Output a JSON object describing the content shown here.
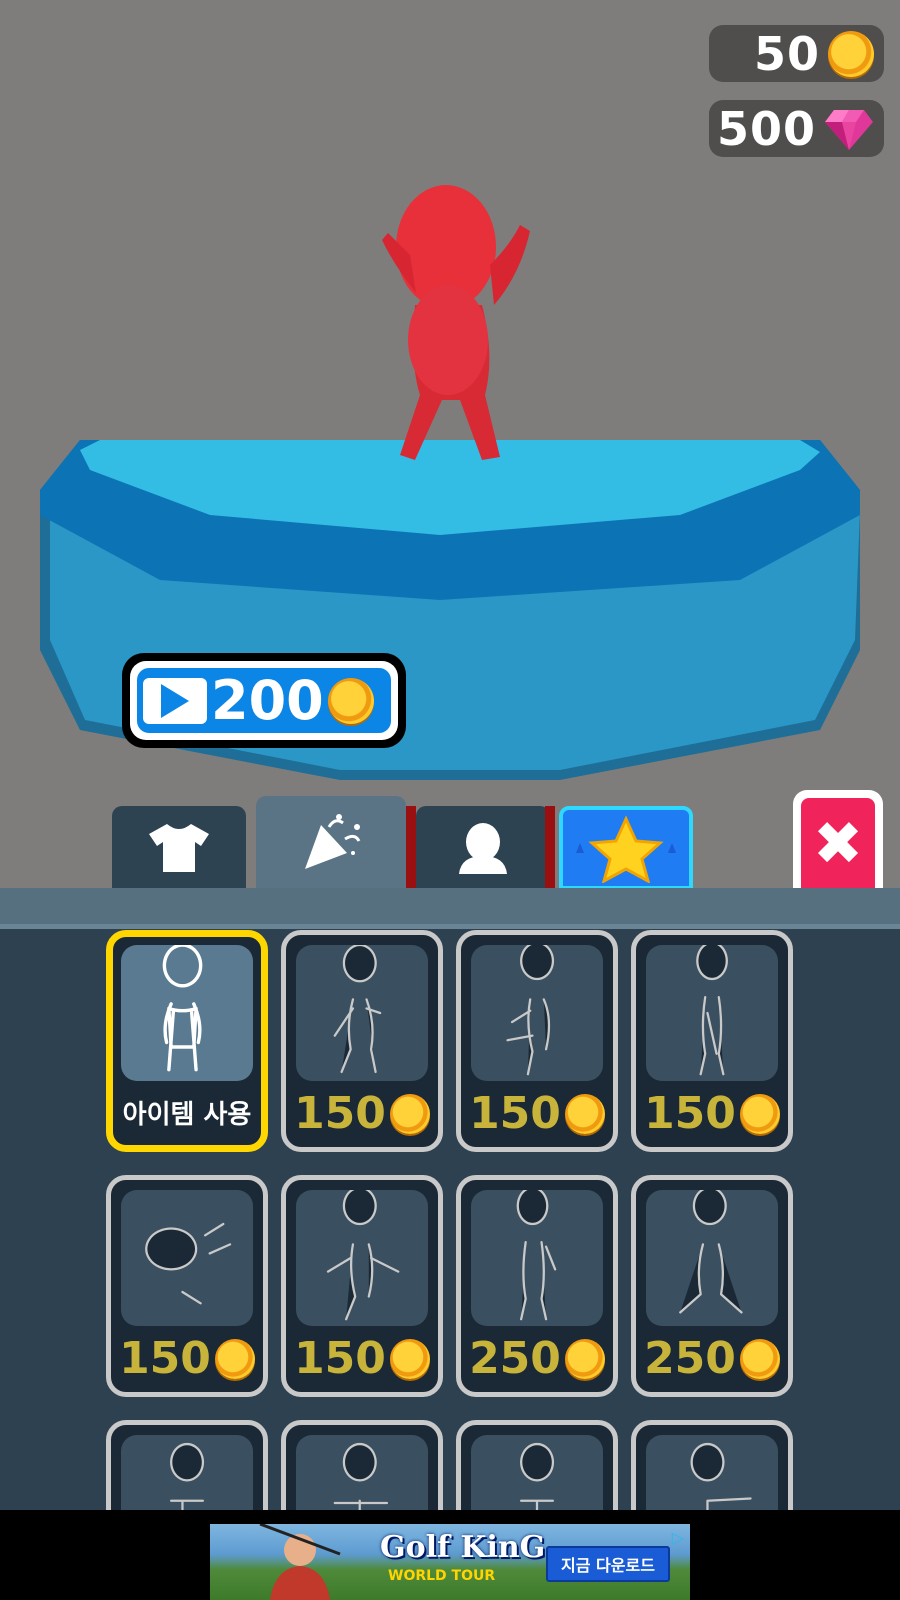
{
  "currency": {
    "coins": "50",
    "gems": "500"
  },
  "video_reward": {
    "amount": "200",
    "icon": "play-icon"
  },
  "tabs": [
    {
      "name": "outfit",
      "icon": "tshirt-icon"
    },
    {
      "name": "celebration",
      "icon": "party-popper-icon"
    },
    {
      "name": "character",
      "icon": "head-icon"
    },
    {
      "name": "special",
      "icon": "star-icon"
    }
  ],
  "close_label": "✖",
  "emotes": [
    {
      "price": "",
      "label": "아이템 사용",
      "selected": true
    },
    {
      "price": "150"
    },
    {
      "price": "150"
    },
    {
      "price": "150"
    },
    {
      "price": "150"
    },
    {
      "price": "150"
    },
    {
      "price": "250"
    },
    {
      "price": "250"
    },
    {
      "price": ""
    },
    {
      "price": ""
    },
    {
      "price": ""
    },
    {
      "price": ""
    }
  ],
  "ad_banner": {
    "title": "Golf KinG",
    "subtitle": "WORLD TOUR",
    "cta": "지금 다운로드"
  },
  "colors": {
    "accent": "#0b86e6",
    "close": "#f0245a",
    "selected": "#ffd700",
    "price": "#c8b43a"
  }
}
